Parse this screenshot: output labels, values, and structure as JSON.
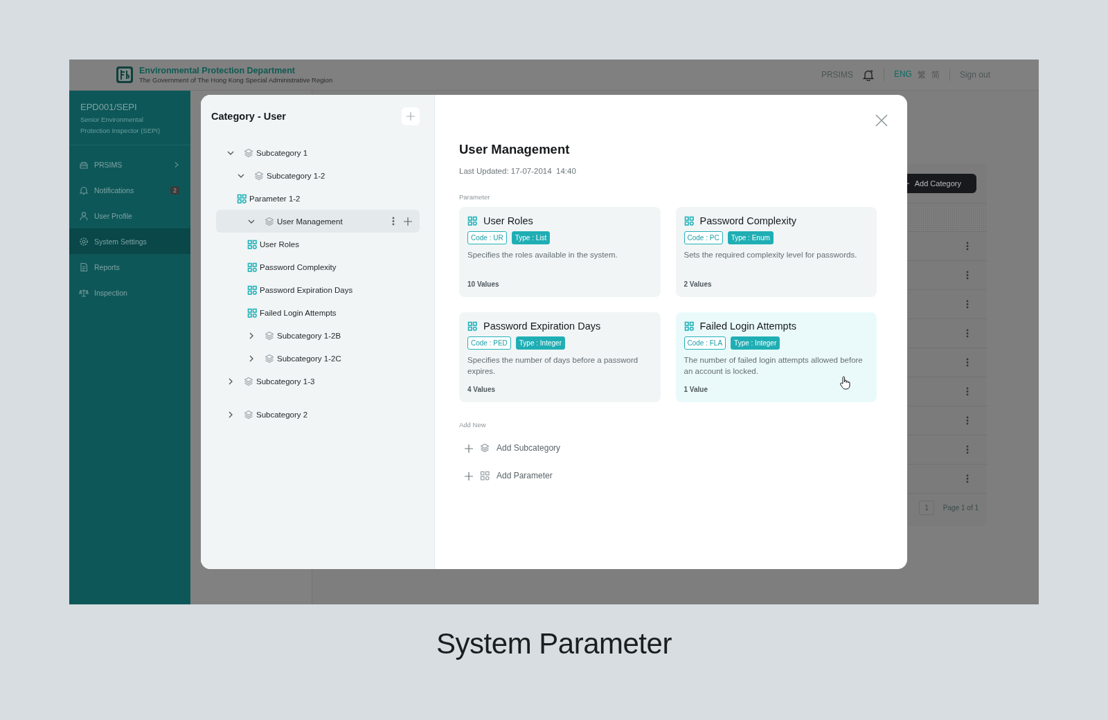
{
  "header": {
    "department": "Environmental Protection Department",
    "government": "The Government of The Hong Kong Special Administrative Region",
    "app_link": "PRSIMS",
    "languages": [
      {
        "label": "ENG",
        "selected": true
      },
      {
        "label": "繁",
        "selected": false
      },
      {
        "label": "简",
        "selected": false
      }
    ],
    "sign_out": "Sign out"
  },
  "sidebar": {
    "user_id": "EPD001/SEPI",
    "user_role": "Senior Environmental Protection Inspector (SEPI)",
    "items": [
      {
        "label": "PRSIMS",
        "selected": false,
        "submenu": true
      },
      {
        "label": "Notifications",
        "selected": false,
        "badge": "2"
      },
      {
        "label": "User Profile",
        "selected": false
      },
      {
        "label": "System Settings",
        "selected": true
      },
      {
        "label": "Reports",
        "selected": false
      },
      {
        "label": "Inspection",
        "selected": false
      }
    ]
  },
  "background_page": {
    "add_button": "Add Category",
    "page_number": "1",
    "page_info": "Page 1 of 1"
  },
  "modal": {
    "tree_title": "Category - User",
    "tree": [
      {
        "label": "Subcategory 1",
        "kind": "subcategory",
        "expanded": true,
        "selected": false,
        "children": [
          {
            "label": "Subcategory 1-2",
            "kind": "subcategory",
            "expanded": true,
            "selected": false,
            "children": [
              {
                "label": "Parameter 1-2",
                "kind": "parameter",
                "selected": false
              },
              {
                "label": "User Management",
                "kind": "subcategory",
                "expanded": true,
                "selected": true,
                "children": [
                  {
                    "label": "User Roles",
                    "kind": "parameter",
                    "selected": false
                  },
                  {
                    "label": "Password Complexity",
                    "kind": "parameter",
                    "selected": false
                  },
                  {
                    "label": "Password Expiration Days",
                    "kind": "parameter",
                    "selected": false
                  },
                  {
                    "label": "Failed Login Attempts",
                    "kind": "parameter",
                    "selected": false
                  }
                ]
              },
              {
                "label": "Subcategory 1-2B",
                "kind": "subcategory",
                "expanded": false,
                "selected": false
              },
              {
                "label": "Subcategory 1-2C",
                "kind": "subcategory",
                "expanded": false,
                "selected": false
              }
            ]
          }
        ]
      },
      {
        "label": "Subcategory 1-3",
        "kind": "subcategory",
        "expanded": false,
        "selected": false
      },
      {
        "label": "Subcategory 2",
        "kind": "subcategory",
        "expanded": false,
        "selected": false
      }
    ],
    "detail": {
      "title": "User Management",
      "last_updated": "Last Updated: 17-07-2014  14:40",
      "parameter_label": "Parameter",
      "parameters": [
        {
          "name": "User Roles",
          "code": "Code : UR",
          "type": "Type : List",
          "description": "Specifies the roles available in the system.",
          "values": "10 Values",
          "highlighted": false
        },
        {
          "name": "Password Complexity",
          "code": "Code : PC",
          "type": "Type : Enum",
          "description": "Sets the required complexity level for passwords.",
          "values": "2 Values",
          "highlighted": false
        },
        {
          "name": "Password Expiration Days",
          "code": "Code : PED",
          "type": "Type : Integer",
          "description": "Specifies the number of days before a password expires.",
          "values": "4 Values",
          "highlighted": false
        },
        {
          "name": "Failed Login Attempts",
          "code": "Code : FLA",
          "type": "Type : Integer",
          "description": "The number of failed login attempts allowed before an account is locked.",
          "values": "1 Value",
          "highlighted": true
        }
      ],
      "add_new_label": "Add New",
      "add_actions": [
        {
          "label": "Add Subcategory",
          "kind": "subcategory"
        },
        {
          "label": "Add Parameter",
          "kind": "parameter"
        }
      ]
    }
  },
  "caption": "System Parameter"
}
